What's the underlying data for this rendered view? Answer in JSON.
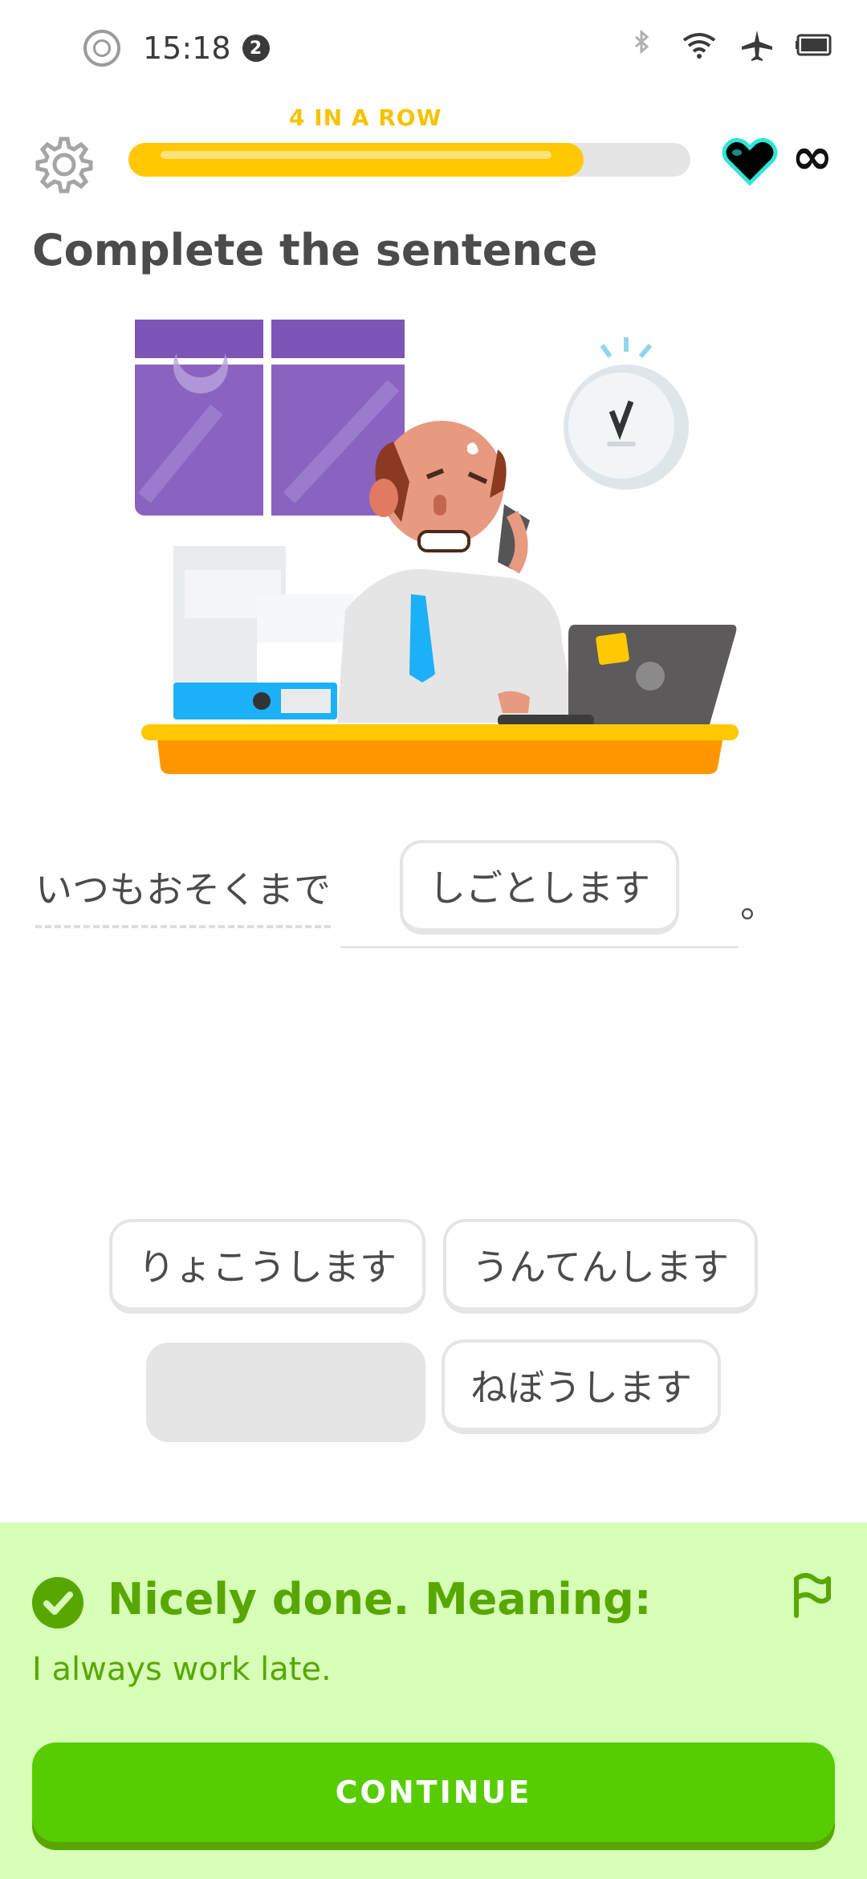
{
  "status_bar": {
    "time": "15:18",
    "notification_count": "2",
    "icons": [
      "record-icon",
      "bluetooth-icon",
      "wifi-icon",
      "airplane-icon",
      "battery-icon"
    ]
  },
  "header": {
    "streak_label": "4 IN A ROW",
    "progress": 0.81,
    "hearts": "∞",
    "colors": {
      "progress": "#ffc800",
      "track": "#e5e5e5"
    }
  },
  "exercise": {
    "title": "Complete the sentence",
    "prompt": "いつもおそくまで",
    "placed_answer": "しごとします",
    "sentence_end": "。"
  },
  "word_bank": {
    "options": [
      "りょこうします",
      "うんてんします",
      "ねぼうします"
    ]
  },
  "feedback": {
    "title": "Nicely done. Meaning:",
    "meaning": "I always work late.",
    "continue_label": "CONTINUE",
    "colors": {
      "background": "#d7ffb8",
      "accent": "#58a700",
      "button": "#58cc02"
    }
  }
}
